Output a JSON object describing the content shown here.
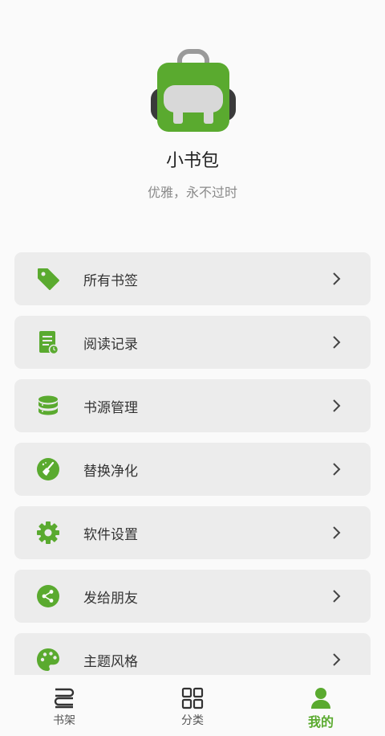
{
  "app": {
    "name": "小书包",
    "slogan": "优雅，永不过时"
  },
  "menu": {
    "items": [
      {
        "label": "所有书签",
        "icon": "tag-icon"
      },
      {
        "label": "阅读记录",
        "icon": "reading-record-icon"
      },
      {
        "label": "书源管理",
        "icon": "database-icon"
      },
      {
        "label": "替换净化",
        "icon": "broom-icon"
      },
      {
        "label": "软件设置",
        "icon": "gear-icon"
      },
      {
        "label": "发给朋友",
        "icon": "share-icon"
      },
      {
        "label": "主题风格",
        "icon": "palette-icon"
      }
    ]
  },
  "tabs": [
    {
      "label": "书架",
      "icon": "bookshelf-icon",
      "active": false
    },
    {
      "label": "分类",
      "icon": "grid-icon",
      "active": false
    },
    {
      "label": "我的",
      "icon": "person-icon",
      "active": true
    }
  ],
  "colors": {
    "accent": "#5aaa2f",
    "item_bg": "#ececec",
    "background": "#fafafa"
  }
}
